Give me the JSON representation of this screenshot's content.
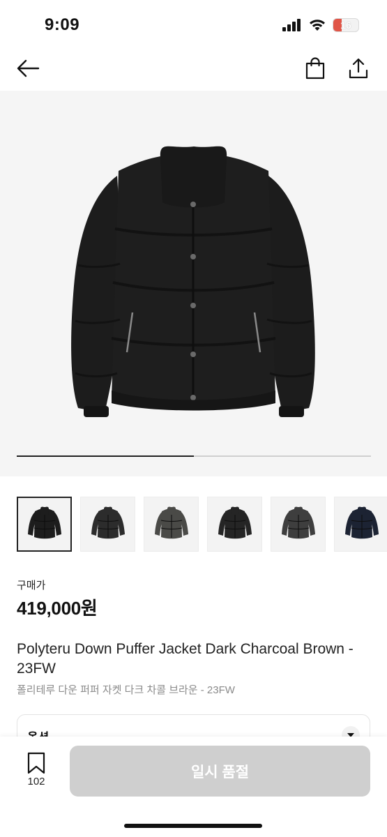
{
  "status_bar": {
    "time": "9:09",
    "battery": "16",
    "battery_color": "#e05547"
  },
  "nav": {
    "icons": [
      "back-arrow-icon",
      "shopping-bag-icon",
      "share-icon"
    ]
  },
  "gallery": {
    "current_image": 1,
    "total_images": 2,
    "progress": 0.5,
    "background": "#f5f5f5",
    "thumbnails": [
      {
        "color": "#1d1d1d",
        "selected": true
      },
      {
        "color": "#2c2c2c",
        "selected": false
      },
      {
        "color": "#4a4a47",
        "selected": false
      },
      {
        "color": "#252525",
        "selected": false
      },
      {
        "color": "#3e3e3e",
        "selected": false
      },
      {
        "color": "#1c2333",
        "selected": false
      }
    ]
  },
  "price": {
    "label": "구매가",
    "value": "419,000원"
  },
  "product": {
    "title": "Polyteru Down Puffer Jacket Dark Charcoal Brown - 23FW",
    "subtitle": "폴리테루 다운 퍼퍼 자켓 다크 차콜 브라운 - 23FW"
  },
  "option": {
    "label": "옵션"
  },
  "bottom_bar": {
    "wish_count": "102",
    "cta_label": "일시 품절",
    "cta_color": "#cfcfcf"
  }
}
